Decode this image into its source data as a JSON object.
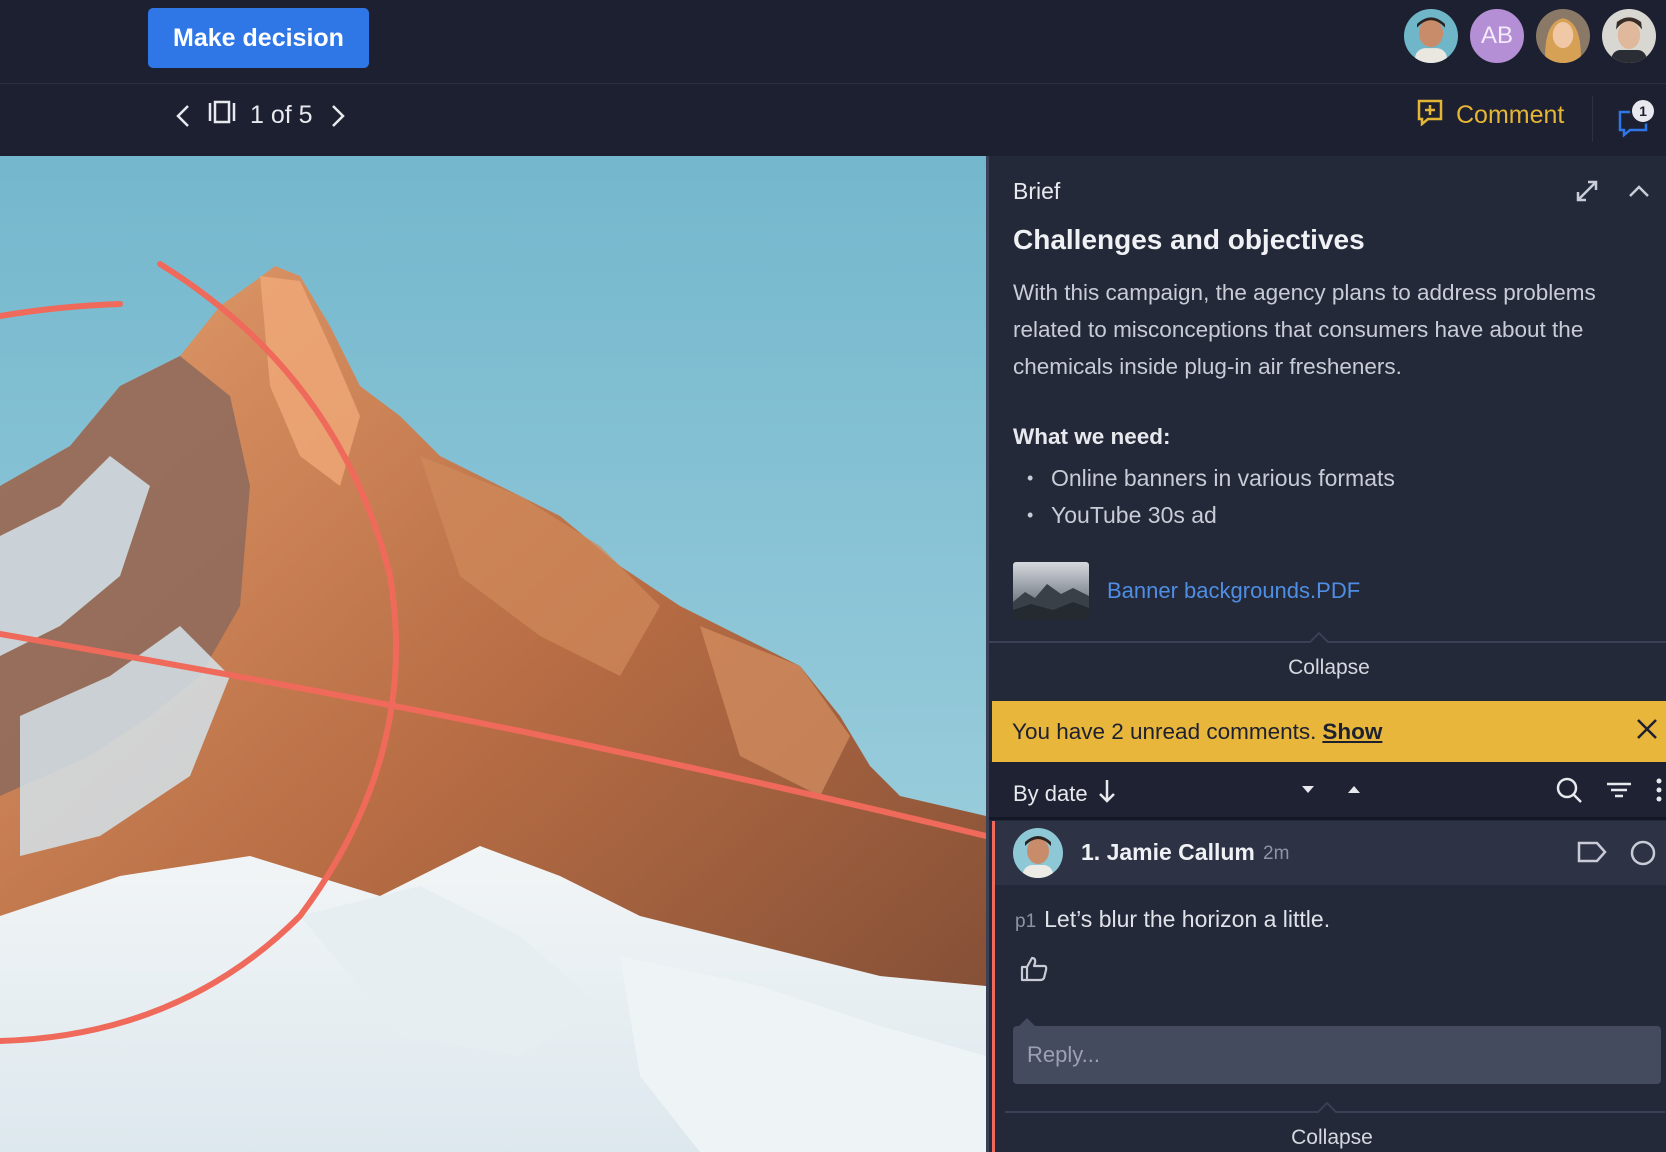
{
  "topbar": {
    "make_decision_label": "Make decision",
    "avatars": [
      {
        "name": "avatar-1",
        "kind": "photo",
        "tone": "#c98c6a"
      },
      {
        "name": "avatar-ab",
        "kind": "initials",
        "initials": "AB",
        "color": "#b58fd6"
      },
      {
        "name": "avatar-3",
        "kind": "photo",
        "tone": "#d8a46a"
      },
      {
        "name": "avatar-4",
        "kind": "photo",
        "tone": "#a07a64"
      }
    ]
  },
  "subbar": {
    "page_indicator": "1 of 5",
    "comment_label": "Comment",
    "comment_count_badge": "1",
    "accent_color": "#e5b535"
  },
  "brief": {
    "heading": "Brief",
    "title": "Challenges and objectives",
    "text": "With this campaign, the agency plans to address problems related to misconceptions that consumers have about the chemicals inside plug-in air fresheners.",
    "need_title": "What we need:",
    "needs": [
      "Online banners in various formats",
      "YouTube 30s ad"
    ],
    "attachment": "Banner backgrounds.PDF",
    "collapse_label": "Collapse"
  },
  "unread": {
    "text": "You have 2 unread comments.",
    "show_label": "Show",
    "color": "#e8b63b"
  },
  "sort": {
    "label": "By date"
  },
  "comment": {
    "author": "1. Jamie Callum",
    "time": "2m",
    "page_ref": "p1",
    "body": "Let’s blur the horizon a little.",
    "reply_placeholder": "Reply...",
    "collapse_label": "Collapse",
    "marker_color": "#ef6a5a"
  }
}
